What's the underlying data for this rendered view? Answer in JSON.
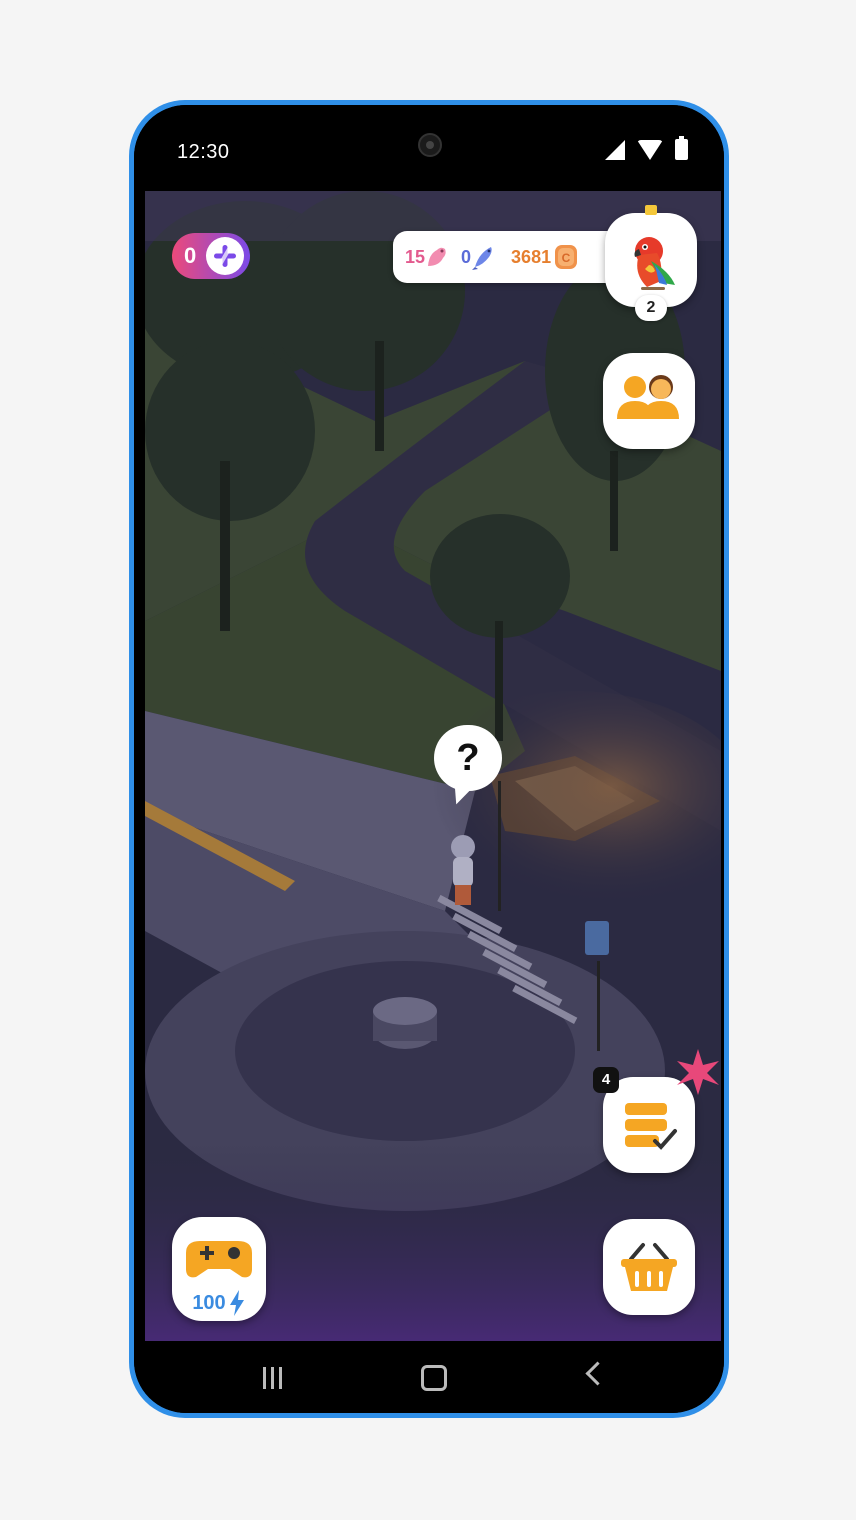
{
  "status_bar": {
    "time": "12:30",
    "icons": [
      "signal-icon",
      "wifi-icon",
      "battery-icon"
    ]
  },
  "hud": {
    "energy": {
      "count": "0",
      "add_icon": "plus-icon"
    },
    "currency": {
      "birds": "15",
      "fish": "0",
      "coins": "3681"
    },
    "parrot": {
      "icon": "parrot-icon",
      "badge": "2"
    },
    "friends": {
      "icon": "friends-icon"
    },
    "tasks": {
      "icon": "tasks-checklist-icon",
      "badge": "4"
    },
    "shop": {
      "icon": "basket-icon"
    },
    "games": {
      "icon": "gamepad-icon",
      "energy_cost": "100"
    }
  },
  "scene": {
    "speech_bubble": "?"
  },
  "nav_bar": {
    "buttons": [
      "recent-apps-icon",
      "home-icon",
      "back-icon"
    ]
  },
  "colors": {
    "frame": "#2f8fe8",
    "energy_gradient_start": "#ec4a7a",
    "energy_gradient_end": "#7b4ae8",
    "birds": "#e35a8e",
    "fish": "#5a6bd8",
    "coins": "#e67f2e",
    "orange_icon": "#f5a623"
  }
}
